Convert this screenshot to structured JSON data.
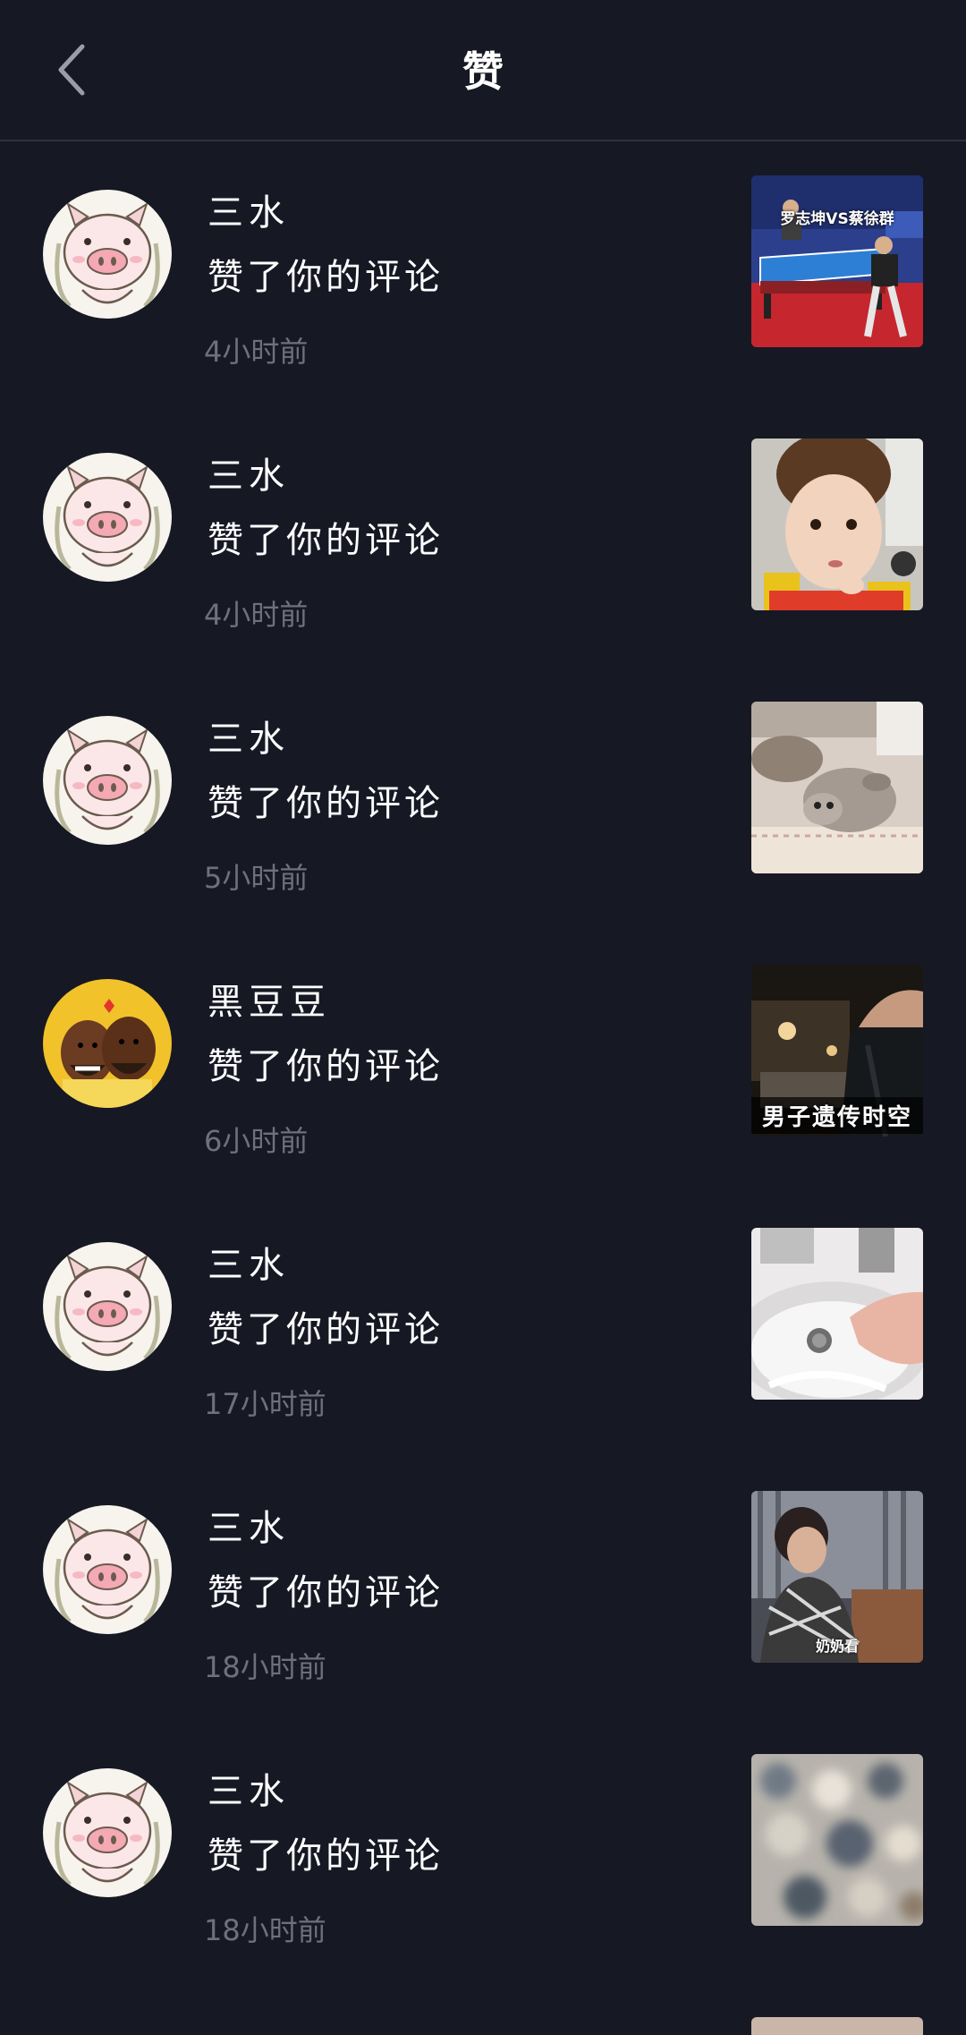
{
  "header": {
    "title": "赞",
    "back_icon": "chevron-left-icon"
  },
  "items": [
    {
      "user": "三水",
      "action": "赞了你的评论",
      "time": "4小时前",
      "avatar": "pig",
      "thumb": "table-tennis",
      "caption": "罗志坤VS蔡徐群"
    },
    {
      "user": "三水",
      "action": "赞了你的评论",
      "time": "4小时前",
      "avatar": "pig",
      "thumb": "child",
      "caption": ""
    },
    {
      "user": "三水",
      "action": "赞了你的评论",
      "time": "5小时前",
      "avatar": "pig",
      "thumb": "kitten",
      "caption": ""
    },
    {
      "user": "黑豆豆",
      "action": "赞了你的评论",
      "time": "6小时前",
      "avatar": "players",
      "thumb": "night-street",
      "caption": "男子遗传时空"
    },
    {
      "user": "三水",
      "action": "赞了你的评论",
      "time": "17小时前",
      "avatar": "pig",
      "thumb": "sink",
      "caption": ""
    },
    {
      "user": "三水",
      "action": "赞了你的评论",
      "time": "18小时前",
      "avatar": "pig",
      "thumb": "grandma",
      "caption": "奶奶看"
    },
    {
      "user": "三水",
      "action": "赞了你的评论",
      "time": "18小时前",
      "avatar": "pig",
      "thumb": "blurred",
      "caption": ""
    }
  ]
}
